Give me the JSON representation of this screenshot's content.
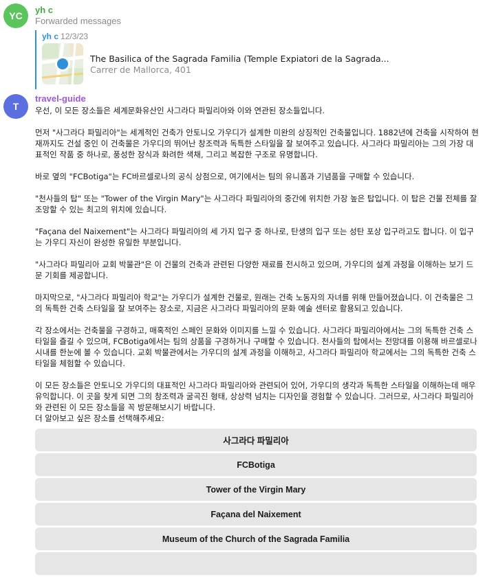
{
  "colors": {
    "avatar_yc": "#5cc45c",
    "avatar_t": "#5b6fe0",
    "sender_yc": "#3fae3f",
    "sender_guide": "#9b59d6",
    "forward_accent": "#2f8fd8",
    "button_bg": "#e6e6e6"
  },
  "message1": {
    "avatar_initials": "YC",
    "sender": "yh c",
    "label": "Forwarded messages",
    "forwarded": {
      "sender": "yh c",
      "date": "12/3/23",
      "icon": "map-pin-icon",
      "title": "The Basilica of the Sagrada Familia (Temple Expiatori de la Sagrada...",
      "address": "Carrer de Mallorca, 401"
    }
  },
  "message2": {
    "avatar_initials": "T",
    "sender": "travel-guide",
    "paragraphs": [
      "우선, 이 모든 장소들은 세계문화유산인 사그라다 파밀리아와 이와 연관된 장소들입니다.",
      "먼저 \"사그라다 파밀리아\"는 세계적인 건축가 안토니오 가우디가 설계한 미완의 상징적인 건축물입니다. 1882년에 건축을 시작하여 현재까지도 건설 중인 이 건축물은 가우디의 뛰어난 창조력과 독특한 스타일을 잘 보여주고 있습니다. 사그라다 파밀리아는 그의 가장 대표적인 작품 중 하나로, 풍성한 장식과 화려한 색채, 그리고 복잡한 구조로 유명합니다.",
      "바로 옆의 \"FCBotiga\"는 FC바르셀로나의 공식 상점으로, 여기에서는 팀의 유니폼과 기념품을 구매할 수 있습니다.",
      "\"천사들의 탑\" 또는 \"Tower of the Virgin Mary\"는 사그라다 파밀리아의 중간에 위치한 가장 높은 탑입니다. 이 탑은 건물 전체를 잘 조망할 수 있는 최고의 위치에 있습니다.",
      "\"Façana del Naixement\"는 사그라다 파밀리아의 세 가지 입구 중 하나로, 탄생의 입구 또는 성탄 포상 입구라고도 합니다. 이 입구는 가우디 자신이 완성한 유일한 부분입니다.",
      "\"사그라다 파밀리아 교회 박물관\"은 이 건물의 건축과 관련된 다양한 재료를 전시하고 있으며, 가우디의 설계 과정을 이해하는 보기 드문 기회를 제공합니다.",
      "마지막으로, \"사그라다 파밀리아 학교\"는 가우디가 설계한 건물로, 원래는 건축 노동자의 자녀를 위해 만들어졌습니다. 이 건축물은 그의 독특한 건축 스타일을 잘 보여주는 장소로, 지금은 사그라다 파밀리아의 문화 예술 센터로 활용되고 있습니다.",
      "각 장소에서는 건축물을 구경하고, 매혹적인 스페인 문화와 이미지를 느낄 수 있습니다. 사그라다 파밀리아에서는 그의 독특한 건축 스타일을 즐길 수 있으며, FCBotiga에서는 팀의 상품을 구경하거나 구매할 수 있습니다. 천사들의 탑에서는 전망대를 이용해 바르셀로나 시내를 한눈에 볼 수 있습니다. 교회 박물관에서는 가우디의 설계 과정을 이해하고, 사그라다 파밀리아 학교에서는 그의 독특한 건축 스타일을 체험할 수 있습니다.",
      "이 모든 장소들은 안토니오 가우디의 대표적인 사그라다 파밀리아와 관련되어 있어, 가우디의 생각과 독특한 스타일을 이해하는데 매우 유익합니다. 이 곳을 찾게 되면 그의 창조력과 굴곡진 형태, 상상력 넘치는 디자인을 경험할 수 있습니다. 그러므로, 사그라다 파밀리아와 관련된 이 모든 장소들을 꼭 방문해보시기 바랍니다."
    ],
    "prompt": "더 알아보고 싶은 장소를 선택해주세요:",
    "buttons": [
      "사그라다 파밀리아",
      "FCBotiga",
      "Tower of the Virgin Mary",
      "Façana del Naixement",
      "Museum of the Church of the Sagrada Familia"
    ]
  }
}
